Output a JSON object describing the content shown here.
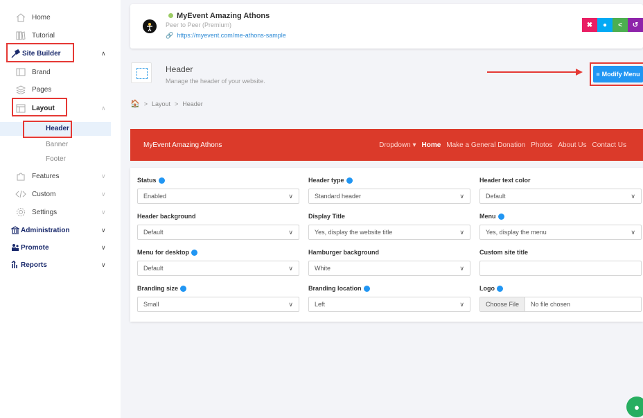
{
  "sidebar": {
    "home": "Home",
    "tutorial": "Tutorial",
    "site_builder": "Site Builder",
    "brand": "Brand",
    "pages": "Pages",
    "layout": "Layout",
    "header": "Header",
    "banner": "Banner",
    "footer": "Footer",
    "features": "Features",
    "custom": "Custom",
    "settings": "Settings",
    "administration": "Administration",
    "promote": "Promote",
    "reports": "Reports",
    "chevron_up": "∧",
    "chevron_down": "∨"
  },
  "event": {
    "title": "MyEvent Amazing Athons",
    "subtitle": "Peer to Peer (Premium)",
    "url": "https://myevent.com/me-athons-sample"
  },
  "page_header": {
    "title": "Header",
    "description": "Manage the header of your website.",
    "modify_menu": "Modify Menu"
  },
  "breadcrumb": {
    "sep": ">",
    "layout": "Layout",
    "header": "Header"
  },
  "preview_nav": {
    "brand": "MyEvent Amazing Athons",
    "links": [
      "Dropdown ▾",
      "Home",
      "Make a General Donation",
      "Photos",
      "About Us",
      "Contact Us"
    ]
  },
  "form": {
    "status_label": "Status",
    "status_value": "Enabled",
    "header_type_label": "Header type",
    "header_type_value": "Standard header",
    "header_text_color_label": "Header text color",
    "header_text_color_value": "Default",
    "header_background_label": "Header background",
    "header_background_value": "Default",
    "display_title_label": "Display Title",
    "display_title_value": "Yes, display the website title",
    "menu_label": "Menu",
    "menu_value": "Yes, display the menu",
    "menu_desktop_label": "Menu for desktop",
    "menu_desktop_value": "Default",
    "hamburger_label": "Hamburger background",
    "hamburger_value": "White",
    "custom_title_label": "Custom site title",
    "custom_title_value": "",
    "branding_size_label": "Branding size",
    "branding_size_value": "Small",
    "branding_location_label": "Branding location",
    "branding_location_value": "Left",
    "logo_label": "Logo",
    "choose_file": "Choose File",
    "no_file": "No file chosen"
  },
  "colors": {
    "accent_red": "#db3a2a",
    "primary_blue": "#2196f3",
    "annotation_red": "#e53935"
  }
}
